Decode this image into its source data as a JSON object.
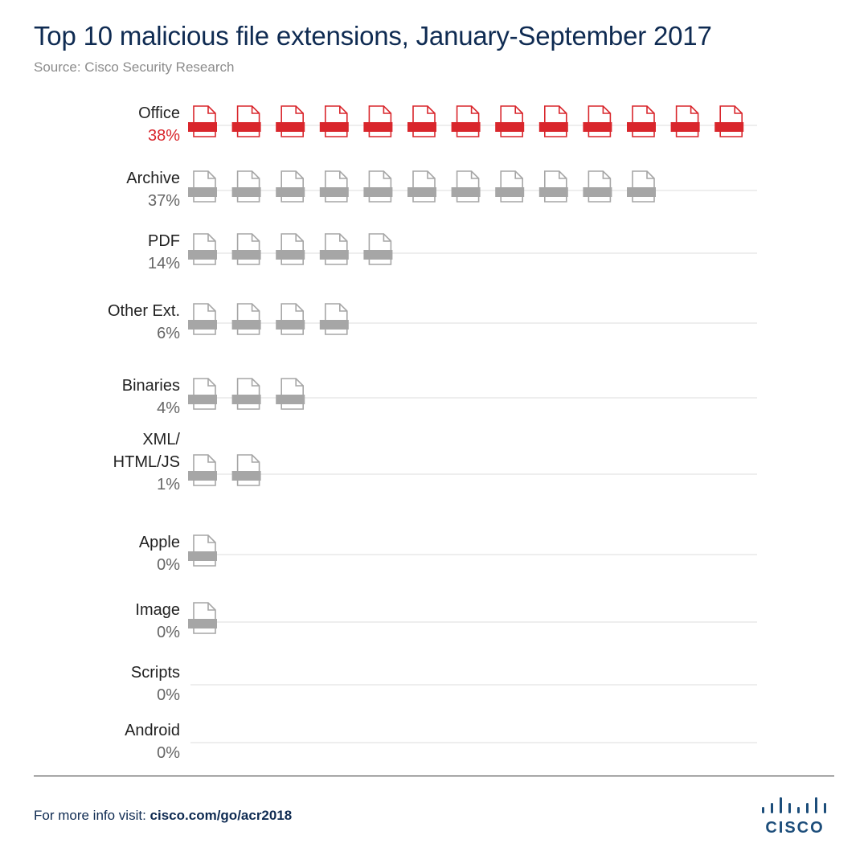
{
  "header": {
    "title": "Top 10 malicious file extensions, January-September 2017",
    "source": "Source: Cisco Security Research"
  },
  "footer": {
    "prefix": "For more info visit: ",
    "link_text": "cisco.com/go/acr2018",
    "logo_text": "CISCO"
  },
  "colors": {
    "highlight": "#d9262c",
    "normal_outline": "#a6a6a6",
    "normal_fill": "#a6a6a6",
    "gridline": "#dddddd",
    "label_text": "#222222",
    "value_text": "#666666",
    "brand_navy": "#0f2b52",
    "logo_blue": "#1c4d7a"
  },
  "chart_data": {
    "type": "pictograph",
    "title": "Top 10 malicious file extensions, January-September 2017",
    "icon": "document-icon",
    "categories": [
      {
        "label": [
          "Office"
        ],
        "value_label": "38%",
        "value": 38,
        "icons": 13,
        "highlight": true
      },
      {
        "label": [
          "Archive"
        ],
        "value_label": "37%",
        "value": 37,
        "icons": 11,
        "highlight": false
      },
      {
        "label": [
          "PDF"
        ],
        "value_label": "14%",
        "value": 14,
        "icons": 5,
        "highlight": false
      },
      {
        "label": [
          "Other Ext."
        ],
        "value_label": "6%",
        "value": 6,
        "icons": 4,
        "highlight": false
      },
      {
        "label": [
          "Binaries"
        ],
        "value_label": "4%",
        "value": 4,
        "icons": 3,
        "highlight": false
      },
      {
        "label": [
          "XML/",
          "HTML/JS"
        ],
        "value_label": "1%",
        "value": 1,
        "icons": 2,
        "highlight": false
      },
      {
        "label": [
          "Apple"
        ],
        "value_label": "0%",
        "value": 0,
        "icons": 1,
        "highlight": false
      },
      {
        "label": [
          "Image"
        ],
        "value_label": "0%",
        "value": 0,
        "icons": 1,
        "highlight": false
      },
      {
        "label": [
          "Scripts"
        ],
        "value_label": "0%",
        "value": 0,
        "icons": 0,
        "highlight": false
      },
      {
        "label": [
          "Android"
        ],
        "value_label": "0%",
        "value": 0,
        "icons": 0,
        "highlight": false
      }
    ],
    "grid": true,
    "legend": "none"
  }
}
